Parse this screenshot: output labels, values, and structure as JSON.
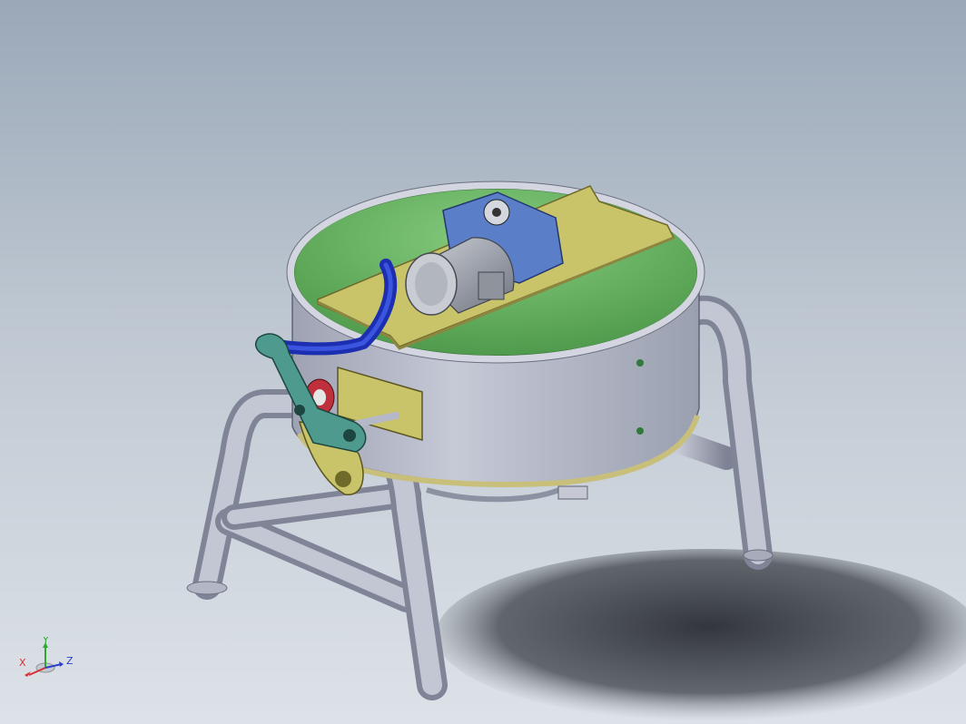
{
  "viewport": {
    "background_top": "#9aa8b8",
    "background_bottom": "#dde2e8"
  },
  "model": {
    "colors": {
      "tube_steel": "#b4b8c8",
      "tube_shadow": "#7e8496",
      "kettle_outer": "#b8bccb",
      "kettle_inner": "#6fb46a",
      "bracket_olive": "#c9c36a",
      "motor_blue": "#5a7fc8",
      "motor_grey": "#a9adb5",
      "hose_blue": "#1b2fb0",
      "handle_teal": "#4f9a8e",
      "bearing_red": "#c0303c"
    },
    "icons": [
      "kettle-body",
      "gear-motor",
      "tilt-handle",
      "support-frame"
    ]
  },
  "triad": {
    "x_label": "X",
    "y_label": "Y",
    "z_label": "Z",
    "x_color": "#d83030",
    "y_color": "#2ea82e",
    "z_color": "#2b3fc8"
  }
}
